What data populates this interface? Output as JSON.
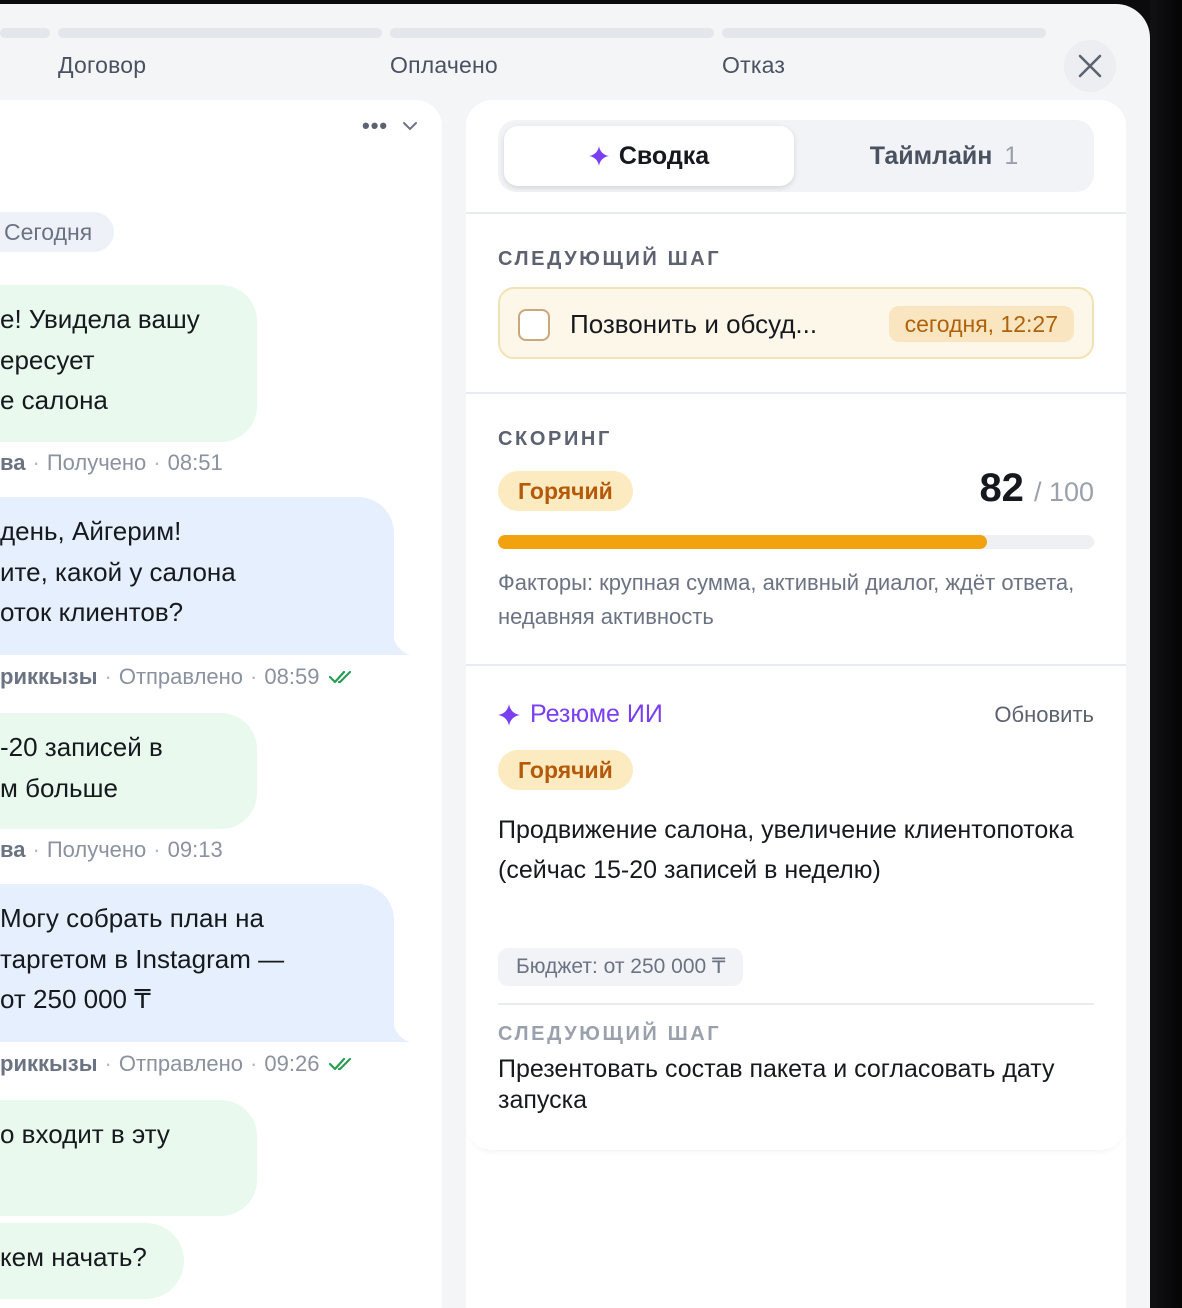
{
  "pipeline": {
    "stages": [
      {
        "label": ""
      },
      {
        "label": "Договор"
      },
      {
        "label": "Оплачено"
      },
      {
        "label": "Отказ"
      }
    ]
  },
  "chat": {
    "date_label": "Сегодня",
    "messages": [
      {
        "direction": "in",
        "lines": [
          "е! Увидела вашу",
          "ересует",
          "е салона"
        ],
        "meta": {
          "author": "ва",
          "status": "Получено",
          "time": "08:51"
        }
      },
      {
        "direction": "out",
        "lines": [
          "день, Айгерим!",
          "ите, какой у салона",
          "оток клиентов?"
        ],
        "meta": {
          "author": "риккызы",
          "status": "Отправлено",
          "time": "08:59"
        }
      },
      {
        "direction": "in",
        "lines": [
          "-20 записей в",
          "м больше"
        ],
        "meta": {
          "author": "ва",
          "status": "Получено",
          "time": "09:13"
        }
      },
      {
        "direction": "out",
        "lines": [
          "Могу собрать план на",
          "таргетом в Instagram —",
          "от 250 000 ₸"
        ],
        "meta": {
          "author": "риккызы",
          "status": "Отправлено",
          "time": "09:26"
        }
      },
      {
        "direction": "in",
        "lines": [
          "о входит в эту",
          ""
        ]
      },
      {
        "direction": "in",
        "lines": [
          "кем начать?"
        ]
      }
    ]
  },
  "tabs": {
    "summary_label": "Сводка",
    "timeline_label": "Таймлайн",
    "timeline_count": "1"
  },
  "next_step": {
    "title": "СЛЕДУЮЩИЙ ШАГ",
    "task_text": "Позвонить и обсуд...",
    "due": "сегодня, 12:27"
  },
  "scoring": {
    "title": "СКОРИНГ",
    "badge": "Горячий",
    "score": "82",
    "score_max": "/ 100",
    "progress_fraction": 0.82,
    "factors": "Факторы: крупная сумма, активный диалог, ждёт ответа, недавняя активность"
  },
  "ai_summary": {
    "title": "Резюме ИИ",
    "refresh_label": "Обновить",
    "badge": "Горячий",
    "text": "Продвижение салона, увеличение клиентопотока (сейчас 15-20 записей в неделю)",
    "budget": "Бюджет: от 250 000 ₸",
    "next_step_title": "СЛЕДУЮЩИЙ ШАГ",
    "next_step_text": "Презентовать состав пакета и согласовать дату запуска"
  },
  "colors": {
    "accent_purple": "#7a3ff0",
    "hot_orange": "#f2a20f",
    "read_check_green": "#2a9d55"
  },
  "icons": {
    "close": "close-icon",
    "sparkle": "sparkle-icon",
    "more": "more-dots-icon",
    "chevron": "chevron-down-icon",
    "read": "double-check-icon"
  }
}
